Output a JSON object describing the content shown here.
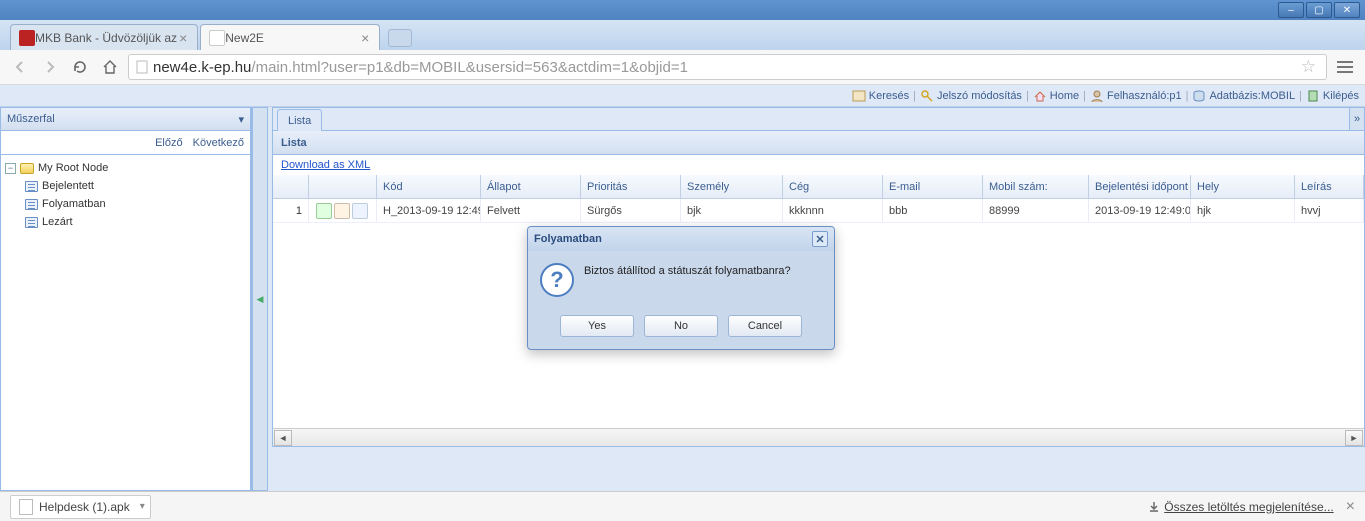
{
  "window": {
    "minimize": "–",
    "maximize": "▢",
    "close": "✕"
  },
  "tabs": [
    {
      "title": "MKB Bank - Üdvözöljük az"
    },
    {
      "title": "New2E"
    }
  ],
  "address": {
    "host": "new4e.k-ep.hu",
    "path": "/main.html?user=p1&db=MOBIL&usersid=563&actdim=1&objid=1"
  },
  "linkbar": {
    "search": "Keresés",
    "password": "Jelszó módosítás",
    "home": "Home",
    "user": "Felhasználó:p1",
    "db": "Adatbázis:MOBIL",
    "logout": "Kilépés"
  },
  "sidebar": {
    "title": "Műszerfal",
    "prev": "Előző",
    "next": "Következő",
    "root": "My Root Node",
    "items": [
      "Bejelentett",
      "Folyamatban",
      "Lezárt"
    ]
  },
  "content": {
    "tab": "Lista",
    "title": "Lista",
    "download": "Download as XML",
    "collapse": "»"
  },
  "grid": {
    "columns": [
      "",
      "",
      "Kód",
      "Állapot",
      "Prioritás",
      "Személy",
      "Cég",
      "E-mail",
      "Mobil szám:",
      "Bejelentési időpont",
      "Hely",
      "Leírás"
    ],
    "rows": [
      {
        "num": "1",
        "kod": "H_2013-09-19 12:49",
        "allapot": "Felvett",
        "prioritas": "Sürgős",
        "szemely": "bjk",
        "ceg": "kkknnn",
        "email": "bbb",
        "mobil": "88999",
        "idopont": "2013-09-19 12:49:0",
        "hely": "hjk",
        "leiras": "hvvj"
      }
    ]
  },
  "dialog": {
    "title": "Folyamatban",
    "message": "Biztos átállítod a státuszát folyamatbanra?",
    "yes": "Yes",
    "no": "No",
    "cancel": "Cancel"
  },
  "downloadbar": {
    "file": "Helpdesk (1).apk",
    "showAll": "Összes letöltés megjelenítése..."
  }
}
